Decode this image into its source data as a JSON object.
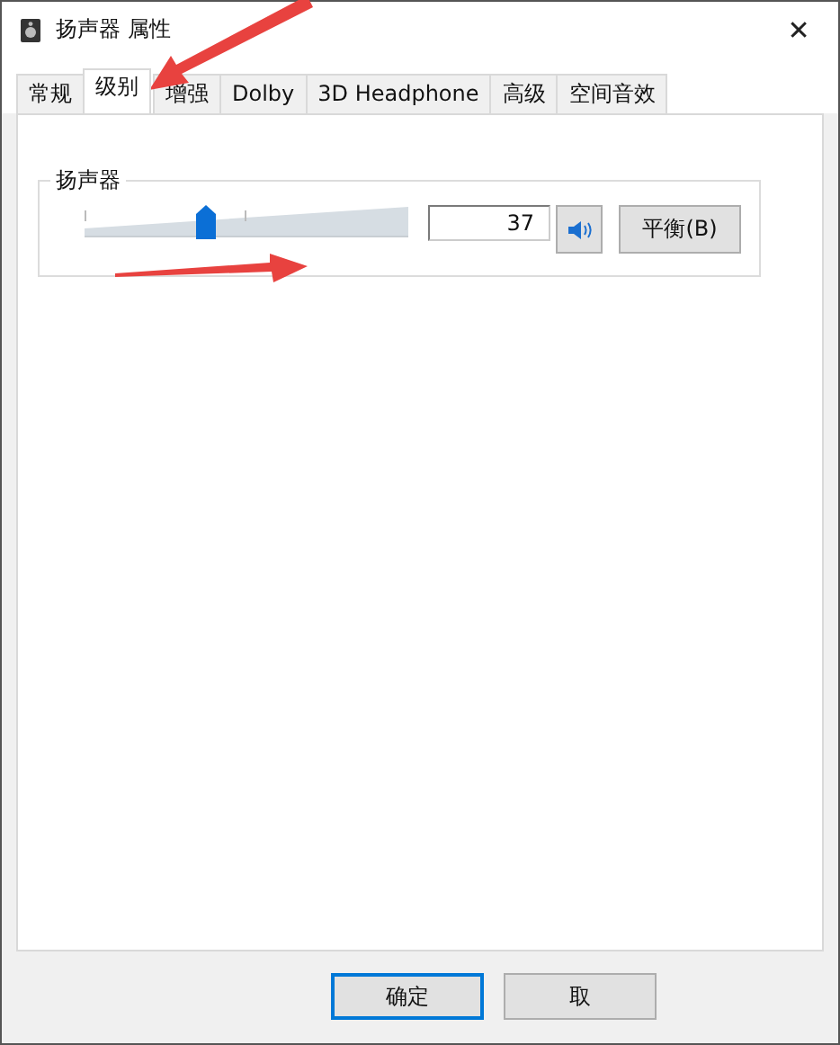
{
  "window": {
    "title": "扬声器 属性",
    "close": "✕"
  },
  "tabs": [
    {
      "label": "常规",
      "selected": false
    },
    {
      "label": "级别",
      "selected": true
    },
    {
      "label": "增强",
      "selected": false
    },
    {
      "label": "Dolby",
      "selected": false
    },
    {
      "label": "3D Headphone",
      "selected": false
    },
    {
      "label": "高级",
      "selected": false
    },
    {
      "label": "空间音效",
      "selected": false
    }
  ],
  "group": {
    "title": "扬声器",
    "slider": {
      "level": 0.37
    },
    "value": "37",
    "muted": false,
    "balance_button": "平衡(B)"
  },
  "buttons": [
    {
      "label": "确定",
      "default": true
    },
    {
      "label": "取",
      "default": false
    }
  ]
}
